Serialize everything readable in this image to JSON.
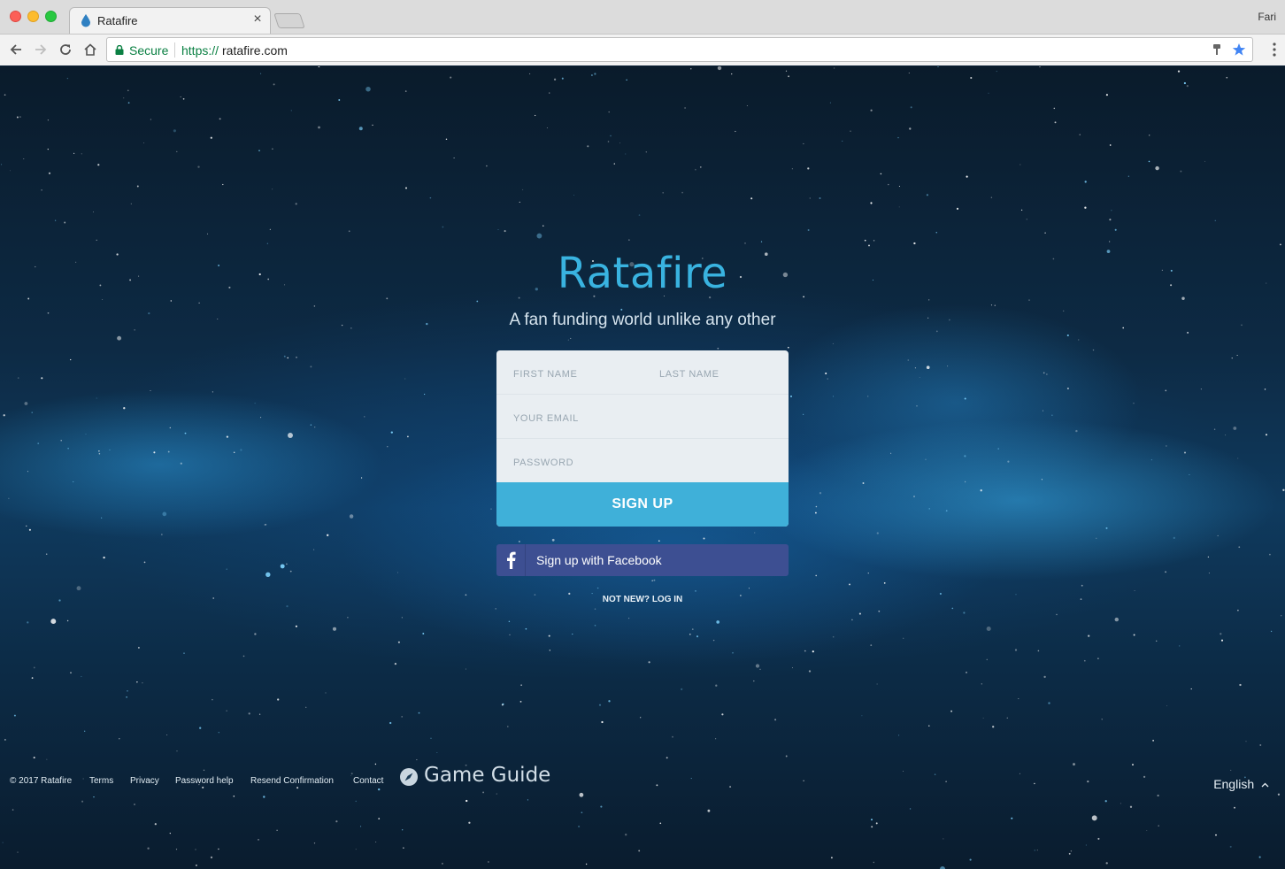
{
  "browser": {
    "tab_title": "Ratafire",
    "tab_close": "×",
    "profile_name": "Fari",
    "secure_label": "Secure",
    "url_scheme": "https://",
    "url_host": "ratafire.com"
  },
  "page": {
    "brand": "Ratafire",
    "tagline": "A fan funding world unlike any other",
    "form": {
      "first_name_placeholder": "FIRST NAME",
      "last_name_placeholder": "LAST NAME",
      "email_placeholder": "YOUR EMAIL",
      "password_placeholder": "PASSWORD",
      "signup_label": "SIGN UP"
    },
    "facebook_label": "Sign up with Facebook",
    "login_link": "NOT NEW? LOG IN"
  },
  "footer": {
    "copyright": "© 2017 Ratafire",
    "terms": "Terms",
    "privacy": "Privacy",
    "password_help": "Password help",
    "resend": "Resend Confirmation",
    "contact": "Contact",
    "game_guide": "Game Guide",
    "language": "English"
  },
  "colors": {
    "brand_blue": "#39b3e0",
    "signup_button": "#3fb0d9",
    "facebook_button": "#3d4f92",
    "secure_green": "#0b8043"
  }
}
